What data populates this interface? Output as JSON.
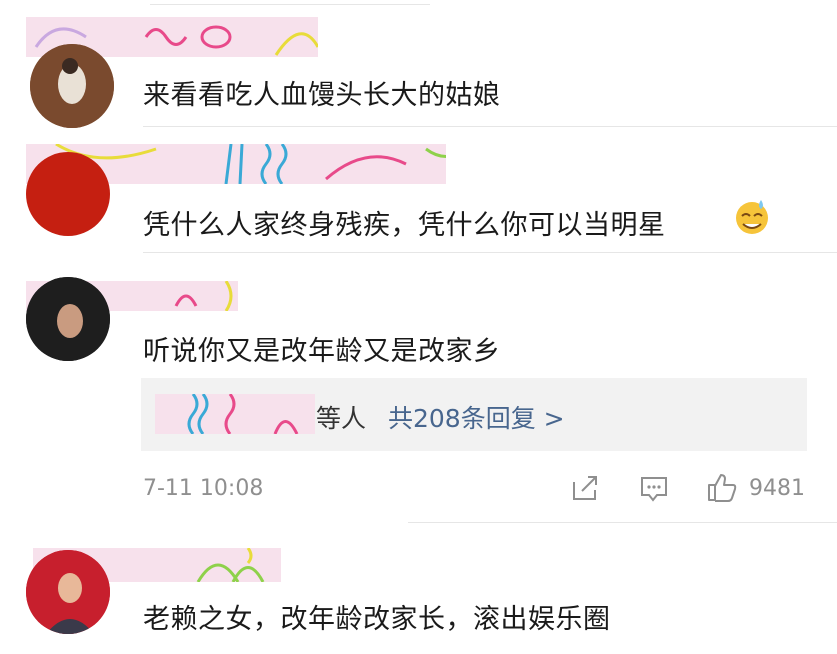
{
  "comments": [
    {
      "text": "来看看吃人血馒头长大的姑娘"
    },
    {
      "text": "凭什么人家终身残疾，凭什么你可以当明星",
      "emoji": "sweat-smile-emoji"
    },
    {
      "text": "听说你又是改年龄又是改家乡",
      "reply_summary": {
        "suffix": "等人",
        "link": "共208条回复 >"
      },
      "timestamp": "7-11 10:08",
      "likes": "9481"
    },
    {
      "text": "老赖之女，改年龄改家长，滚出娱乐圈"
    }
  ],
  "colors": {
    "link": "#48668e",
    "meta": "#8f8f8f",
    "redaction": "#f7e1ec"
  }
}
